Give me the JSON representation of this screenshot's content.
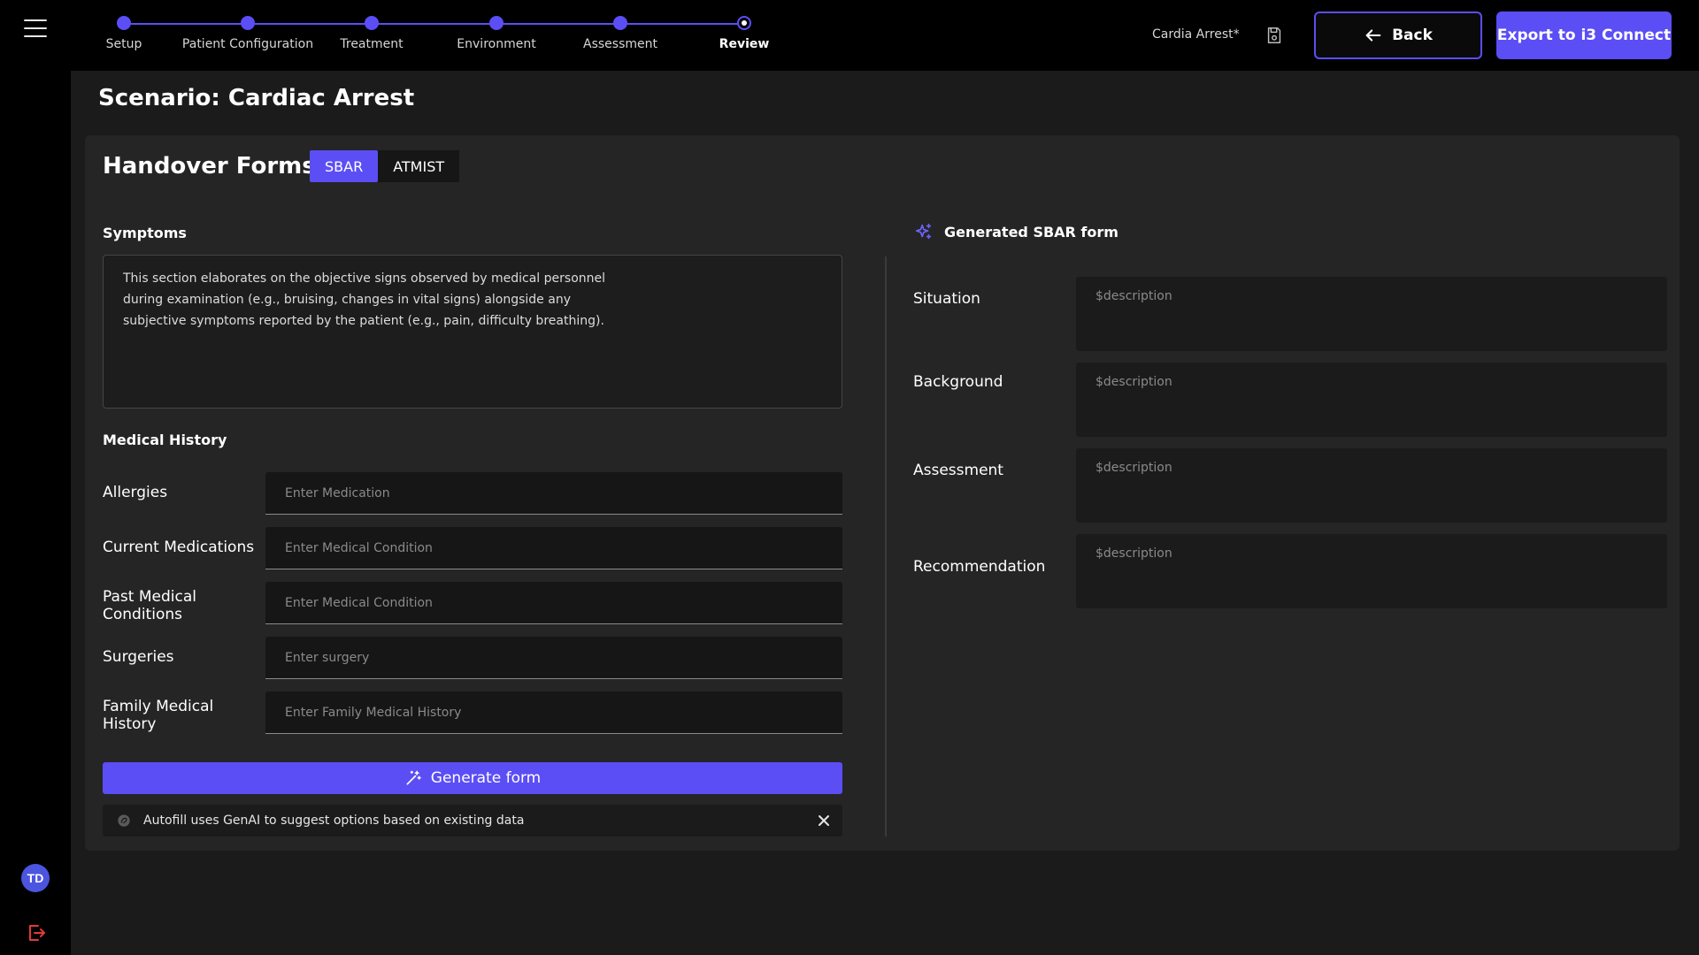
{
  "stepper": {
    "steps": [
      {
        "label": "Setup"
      },
      {
        "label": "Patient Configuration"
      },
      {
        "label": "Treatment"
      },
      {
        "label": "Environment"
      },
      {
        "label": "Assessment"
      },
      {
        "label": "Review"
      }
    ],
    "current_index": 5
  },
  "header": {
    "file_name": "Cardia Arrest*",
    "back_label": "Back",
    "export_label": "Export to i3 Connect"
  },
  "scenario": {
    "title": "Scenario: Cardiac Arrest"
  },
  "handover": {
    "title": "Handover Forms:",
    "tabs": [
      {
        "label": "SBAR",
        "active": true
      },
      {
        "label": "ATMIST",
        "active": false
      }
    ]
  },
  "symptoms": {
    "label": "Symptoms",
    "text": "This section elaborates on the objective signs observed by medical personnel during examination (e.g., bruising, changes in vital signs) alongside any subjective symptoms reported by the patient (e.g., pain, difficulty breathing)."
  },
  "medical_history": {
    "label": "Medical History",
    "fields": [
      {
        "label": "Allergies",
        "placeholder": "Enter Medication"
      },
      {
        "label": "Current Medications",
        "placeholder": "Enter Medical Condition"
      },
      {
        "label": "Past Medical Conditions",
        "placeholder": "Enter Medical Condition"
      },
      {
        "label": "Surgeries",
        "placeholder": "Enter surgery"
      },
      {
        "label": "Family Medical History",
        "placeholder": "Enter Family Medical History"
      }
    ]
  },
  "generate_button": {
    "label": "Generate form"
  },
  "notice": {
    "text": "Autofill uses GenAI to suggest options based on existing data"
  },
  "generated": {
    "title": "Generated SBAR form",
    "rows": [
      {
        "label": "Situation",
        "value": "$description"
      },
      {
        "label": "Background",
        "value": "$description"
      },
      {
        "label": "Assessment",
        "value": "$description"
      },
      {
        "label": "Recommendation",
        "value": "$description"
      }
    ]
  },
  "user": {
    "initials": "TD"
  },
  "colors": {
    "accent": "#5b4ef5",
    "background": "#1b1b1c",
    "card": "#252526",
    "logout": "#e53935"
  },
  "icons": [
    "menu-icon",
    "save-icon",
    "arrow-left-icon",
    "sparkle-icon",
    "magic-wand-icon",
    "ai-icon",
    "close-icon",
    "logout-icon"
  ]
}
